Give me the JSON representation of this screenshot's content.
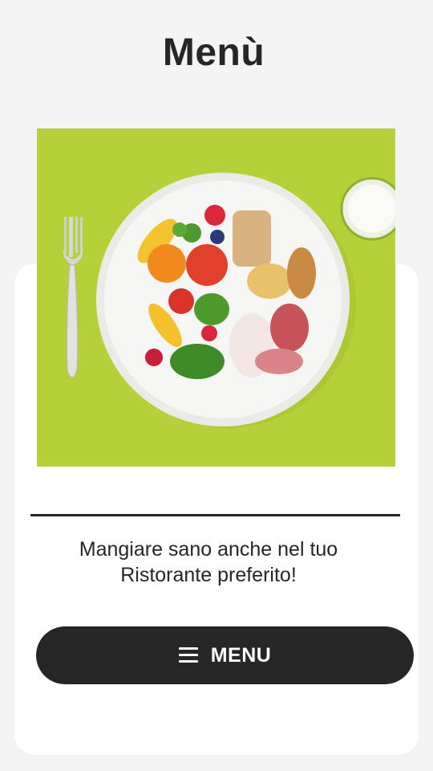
{
  "header": {
    "title": "Menù"
  },
  "hero_image": {
    "icon": "healthy-plate-image",
    "background_color": "#b6d23b"
  },
  "content": {
    "tagline_line1": "Mangiare sano anche nel tuo",
    "tagline_line2": "Ristorante preferito!"
  },
  "menu_button": {
    "icon": "hamburger-icon",
    "label": "MENU",
    "color": "#262626"
  }
}
